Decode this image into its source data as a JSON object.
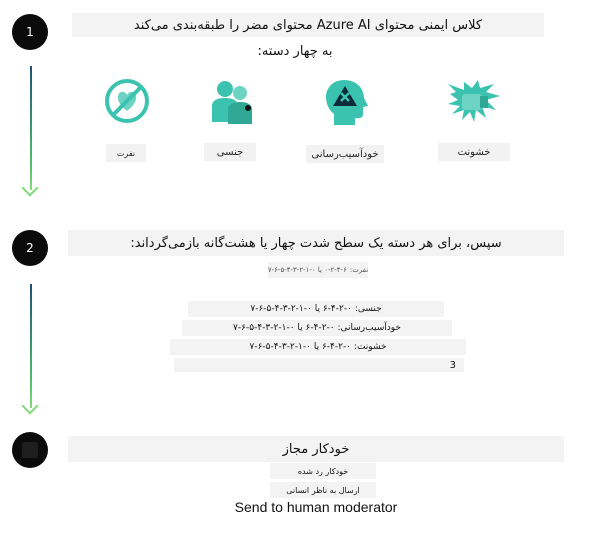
{
  "steps": [
    "1",
    "2",
    ""
  ],
  "step1": {
    "title_line1": "کلاس ایمنی محتوای Azure AI محتوای مضر را طبقه‌بندی می‌کند",
    "title_line2": "به چهار دسته:",
    "categories": [
      {
        "label": "نفرت",
        "icon": "no-hate-icon"
      },
      {
        "label": "جنسی",
        "icon": "people-icon"
      },
      {
        "label": "خودآسیب‌رسانی",
        "icon": "head-x-icon"
      },
      {
        "label": "خشونت",
        "icon": "fist-icon"
      }
    ]
  },
  "step2": {
    "title": "سپس، برای هر دسته یک سطح شدت چهار یا هشت‌گانه بازمی‌گرداند:",
    "tiny_label": "نفرت:",
    "tiny_values": "۰-۲-۴-۶ یا ۰-۱-۲-۳-۴-۵-۶-۷",
    "rows": [
      "جنسی: ۰-۲-۴-۶ یا ۰-۱-۲-۳-۴-۵-۶-۷",
      "خودآسیب‌رسانی: ۰-۲-۴-۶ یا ۰-۱-۲-۳-۴-۵-۶-۷",
      "خشونت: ۰-۲-۴-۶ یا ۰-۱-۲-۳-۴-۵-۶-۷",
      "3"
    ]
  },
  "step3": {
    "title": "خودکار مجاز",
    "option1": "خودکار رد شده",
    "option2": "ارسال به ناظر انسانی",
    "footer": "Send to human moderator"
  },
  "colors": {
    "teal": "#3cc3b0",
    "dark_teal": "#1f9b8a",
    "line_top": "#1f4e79",
    "line_bottom": "#7fdc78"
  }
}
